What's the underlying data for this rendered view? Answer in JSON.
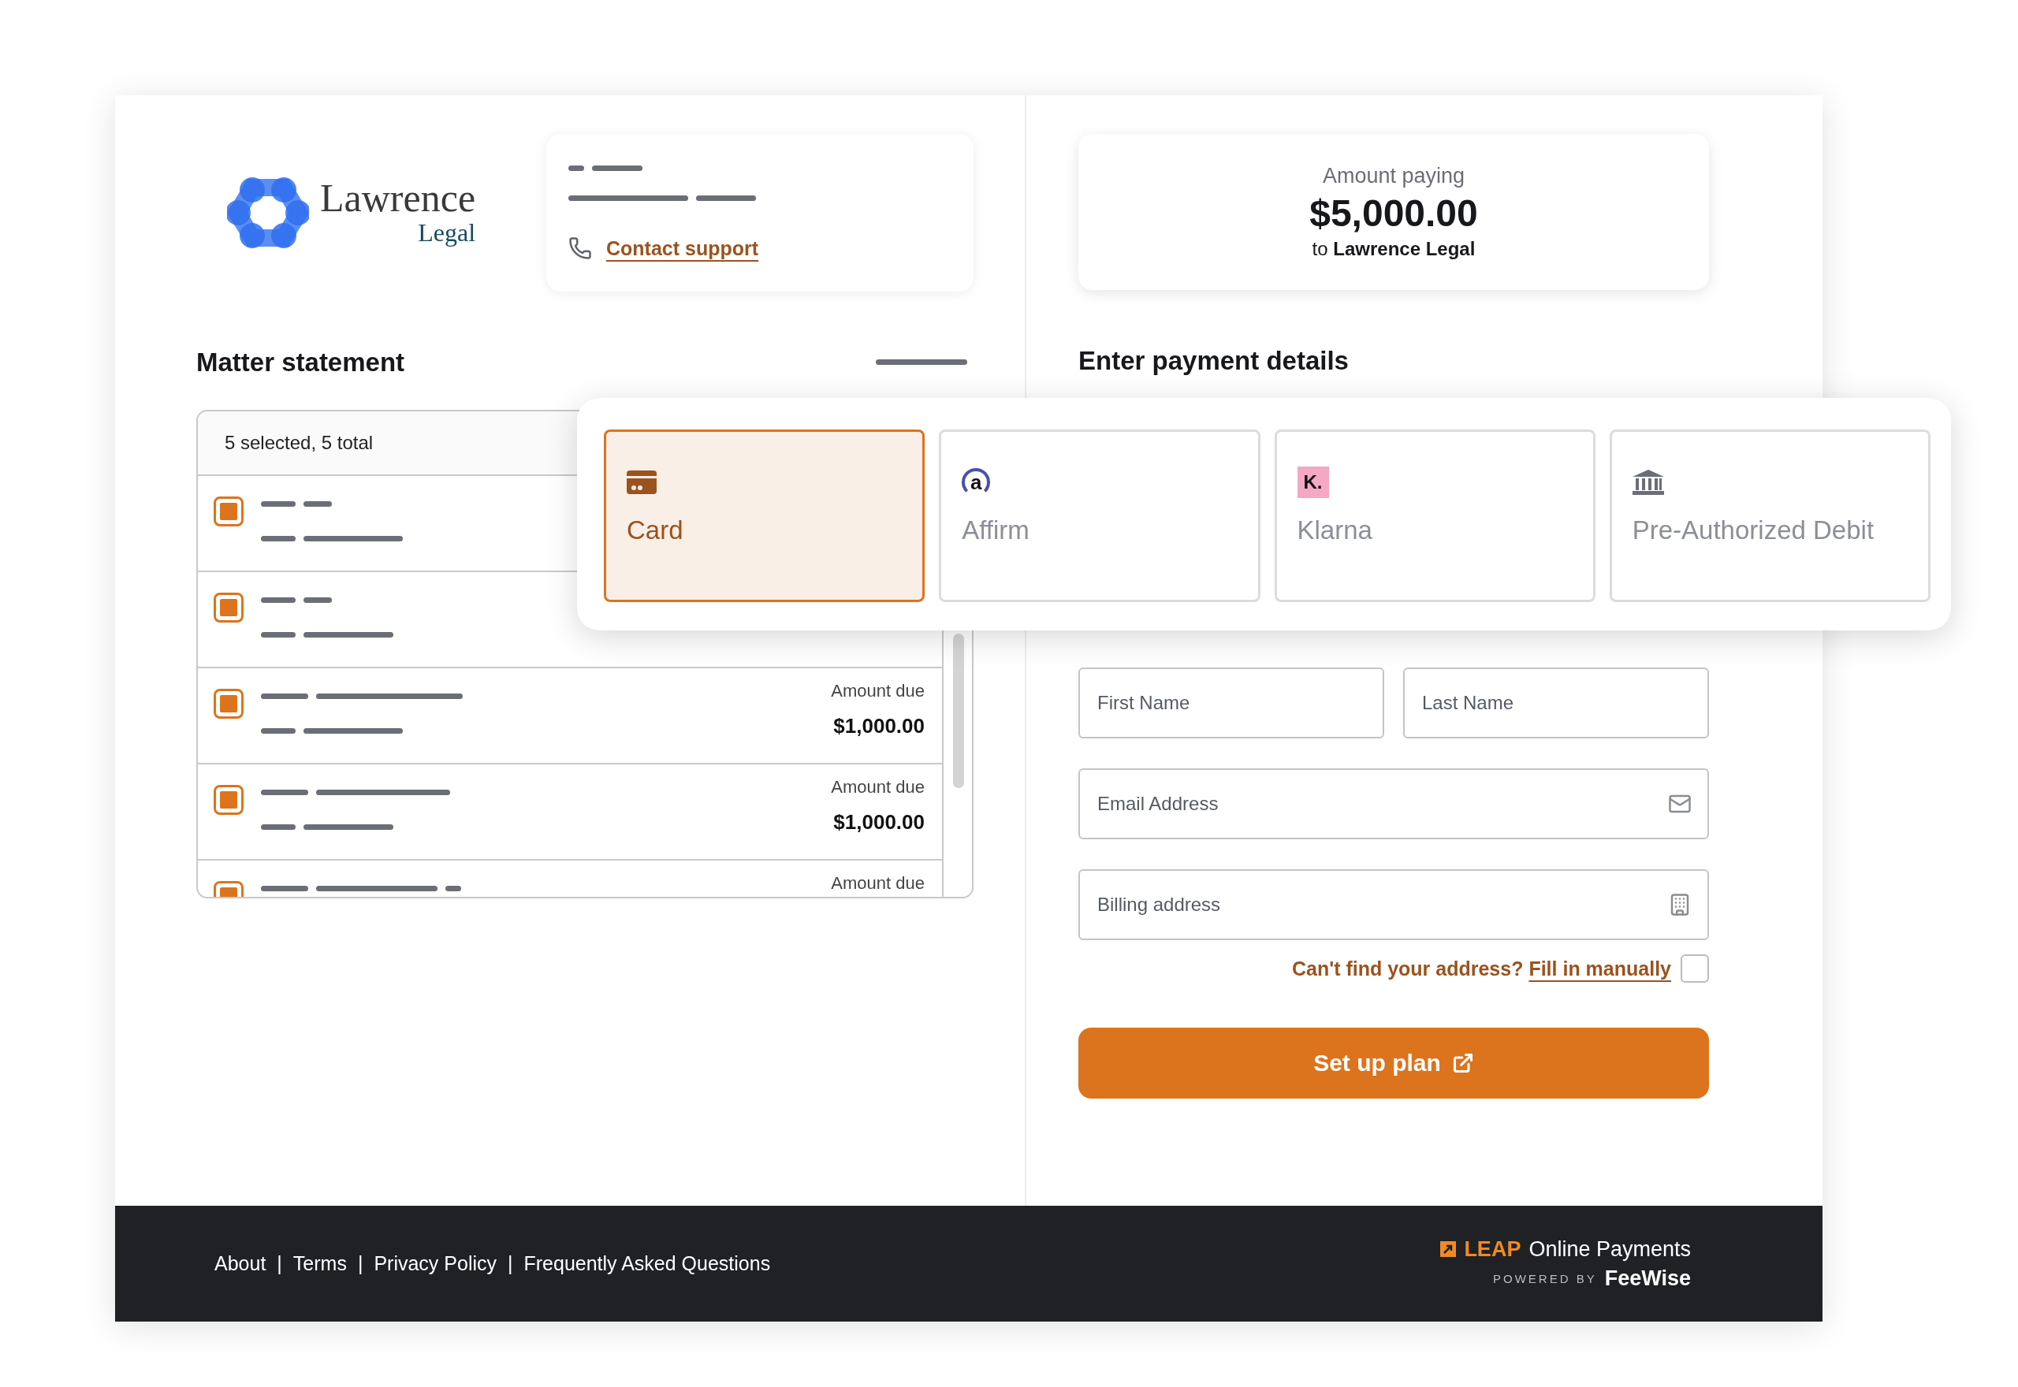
{
  "logo": {
    "name": "Lawrence",
    "subtitle": "Legal"
  },
  "contact": {
    "link": "Contact support"
  },
  "amount": {
    "label": "Amount paying",
    "value": "$5,000.00",
    "prefix": "to",
    "payee": "Lawrence Legal"
  },
  "matter": {
    "title": "Matter statement",
    "summary": "5 selected, 5 total",
    "rows": [
      {
        "checked": true
      },
      {
        "checked": true
      },
      {
        "checked": true,
        "label": "Amount due",
        "amount": "$1,000.00"
      },
      {
        "checked": true,
        "label": "Amount due",
        "amount": "$1,000.00"
      },
      {
        "checked": true,
        "label": "Amount due"
      }
    ]
  },
  "payment": {
    "title": "Enter payment details",
    "methods": [
      {
        "kind": "card",
        "label": "Card",
        "selected": true
      },
      {
        "kind": "affirm",
        "badge": "a",
        "label": "Affirm",
        "selected": false
      },
      {
        "kind": "klarna",
        "badge": "K.",
        "label": "Klarna",
        "selected": false
      },
      {
        "kind": "bank",
        "label": "Pre-Authorized Debit",
        "selected": false
      }
    ],
    "fields": [
      {
        "kind": "first",
        "placeholder": "First Name"
      },
      {
        "kind": "last",
        "placeholder": "Last Name"
      },
      {
        "kind": "email",
        "placeholder": "Email Address"
      },
      {
        "kind": "address",
        "placeholder": "Billing address"
      }
    ],
    "manual_address": {
      "question": "Can't find your address?",
      "link": "Fill in manually",
      "checked": false
    },
    "submit": "Set up plan"
  },
  "footer": {
    "links": [
      "About",
      "Terms",
      "Privacy Policy",
      "Frequently Asked Questions"
    ],
    "separators": [
      "|",
      "|",
      "|"
    ],
    "brand": "LEAP",
    "product": "Online Payments",
    "powered_by": "POWERED BY",
    "partner": "FeeWise"
  }
}
